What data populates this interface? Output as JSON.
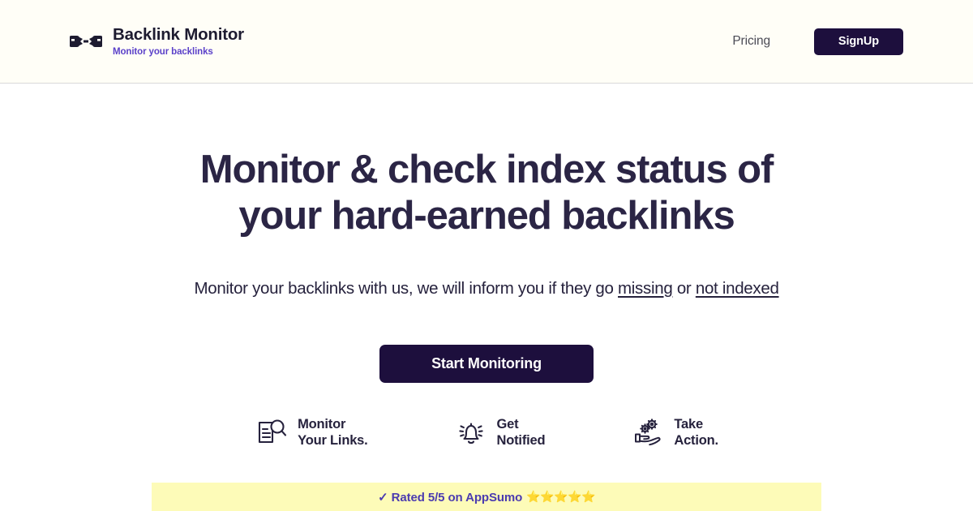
{
  "header": {
    "logo_icon": "broken-chain-link-icon",
    "brand_title": "Backlink Monitor",
    "brand_tagline": "Monitor your backlinks",
    "nav": {
      "pricing_label": "Pricing",
      "signup_label": "SignUp"
    }
  },
  "hero": {
    "title": "Monitor & check index status of your hard-earned backlinks",
    "subtitle_part1": "Monitor your backlinks with us, we will inform you if they go ",
    "subtitle_emph1": "missing",
    "subtitle_part2": " or ",
    "subtitle_emph2": "not indexed",
    "cta_label": "Start Monitoring"
  },
  "features": [
    {
      "icon": "document-magnifier-icon",
      "label": "Monitor\nYour Links."
    },
    {
      "icon": "ringing-bell-icon",
      "label": "Get\nNotified"
    },
    {
      "icon": "hand-gears-icon",
      "label": "Take\nAction."
    }
  ],
  "rating_banner": {
    "text": "✓ Rated 5/5 on AppSumo",
    "stars": "⭐⭐⭐⭐⭐"
  },
  "colors": {
    "header_bg": "#fffef7",
    "brand_purple": "#5b41c9",
    "ink": "#1d0f3d",
    "heading": "#2b2545",
    "banner_bg": "#fdfbb8",
    "banner_text": "#4b3bb0"
  }
}
